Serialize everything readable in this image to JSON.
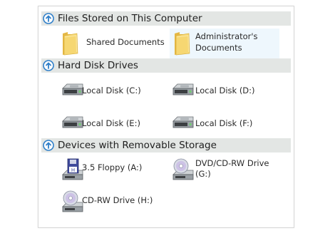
{
  "groups": [
    {
      "title": "Files Stored on This Computer",
      "items": [
        {
          "label": "Shared Documents",
          "icon": "folder-icon",
          "highlighted": false
        },
        {
          "label_line1": "Administrator's",
          "label_line2": "Documents",
          "icon": "folder-icon",
          "highlighted": true
        }
      ]
    },
    {
      "title": "Hard Disk Drives",
      "items": [
        {
          "label": "Local Disk (C:)",
          "icon": "hard-disk-icon"
        },
        {
          "label": "Local Disk (D:)",
          "icon": "hard-disk-icon"
        },
        {
          "label": "Local Disk (E:)",
          "icon": "hard-disk-icon"
        },
        {
          "label": "Local Disk (F:)",
          "icon": "hard-disk-icon"
        }
      ]
    },
    {
      "title": "Devices with Removable Storage",
      "items": [
        {
          "label": "3.5 Floppy (A:)",
          "icon": "floppy-drive-icon"
        },
        {
          "label_line1": "DVD/CD-RW Drive",
          "label_line2": "(G:)",
          "icon": "dvd-drive-icon"
        },
        {
          "label": "CD-RW Drive (H:)",
          "icon": "cd-drive-icon"
        }
      ]
    }
  ],
  "colors": {
    "header_bg": "#e3e6e4",
    "arrow_blue": "#2f7fc9",
    "folder_yellow": "#f4d36b",
    "highlight_bg": "#eef7fd"
  }
}
